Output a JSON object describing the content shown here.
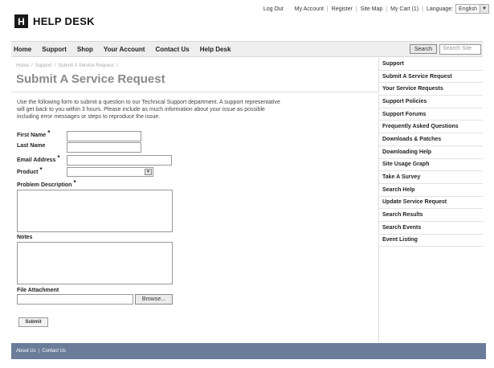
{
  "utility": {
    "logout": "Log Out",
    "my_account": "My Account",
    "register": "Register",
    "site_map": "Site Map",
    "my_cart": "My Cart (1)",
    "language_label": "Language:",
    "language_value": "English"
  },
  "logo": {
    "mark": "H",
    "text": "HELP DESK"
  },
  "nav": {
    "items": [
      "Home",
      "Support",
      "Shop",
      "Your Account",
      "Contact Us",
      "Help Desk"
    ],
    "search_button": "Search",
    "search_placeholder": "Search Site"
  },
  "breadcrumb": [
    "Home",
    "Support",
    "Submit A Service Request"
  ],
  "page_title": "Submit A Service Request",
  "intro": "Use the following form to submit a question to our Technical Support department. A support representative will get back to you within 3 hours. Please include as much information about your issue as possible including error messages or steps to reproduce the issue.",
  "form": {
    "first_name": "First Name",
    "last_name": "Last Name",
    "email": "Email Address",
    "product": "Product",
    "problem": "Problem Description",
    "notes": "Notes",
    "attachment": "File Attachment",
    "browse": "Browse...",
    "submit": "Submit",
    "required_mark": "*"
  },
  "sidebar": {
    "items": [
      "Support",
      "Submit A Service Request",
      "Your Service Requests",
      "Support Policies",
      "Support Forums",
      "Frequently Asked Questions",
      "Downloads & Patches",
      "Downloading Help",
      "Site Usage Graph",
      "Take A Survey",
      "Search Help",
      "Update Service Request",
      "Search Results",
      "Search Events",
      "Event Listing"
    ]
  },
  "footer": {
    "about": "About Us",
    "contact": "Contact Us"
  },
  "colors": {
    "footer_bg": "#6a7c99",
    "title_gray": "#8a8a8a",
    "nav_bg": "#eeeeee"
  }
}
